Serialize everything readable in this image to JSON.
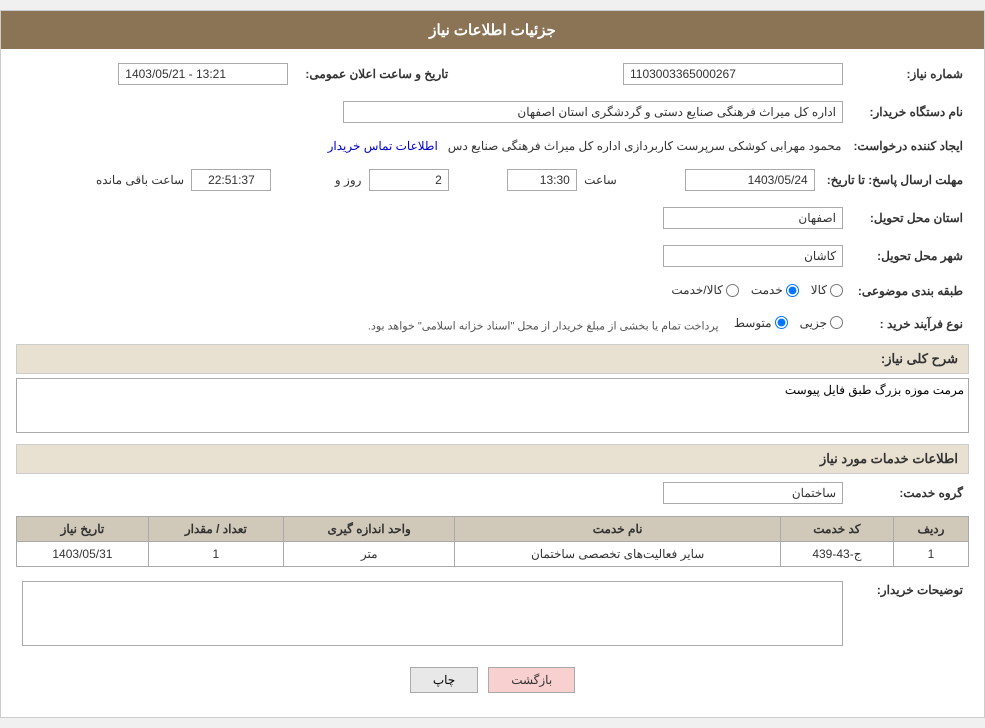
{
  "header": {
    "title": "جزئیات اطلاعات نیاز"
  },
  "fields": {
    "need_number_label": "شماره نیاز:",
    "need_number_value": "1103003365000267",
    "buyer_org_label": "نام دستگاه خریدار:",
    "buyer_org_value": "اداره کل میراث فرهنگی  صنایع دستی و گردشگری استان اصفهان",
    "creator_label": "ایجاد کننده درخواست:",
    "creator_value": "محمود مهرابی کوشکی سرپرست کاربردازی اداره کل میراث فرهنگی  صنایع دس",
    "creator_link": "اطلاعات تماس خریدار",
    "announce_date_label": "تاریخ و ساعت اعلان عمومی:",
    "announce_date_value": "1403/05/21 - 13:21",
    "response_deadline_label": "مهلت ارسال پاسخ: تا تاریخ:",
    "response_date": "1403/05/24",
    "response_time_label": "ساعت",
    "response_time": "13:30",
    "response_days_label": "روز و",
    "response_days": "2",
    "response_remaining_label": "ساعت باقی مانده",
    "response_remaining": "22:51:37",
    "province_label": "استان محل تحویل:",
    "province_value": "اصفهان",
    "city_label": "شهر محل تحویل:",
    "city_value": "کاشان",
    "category_label": "طبقه بندی موضوعی:",
    "category_options": [
      {
        "label": "کالا",
        "value": "kala"
      },
      {
        "label": "خدمت",
        "value": "khedmat"
      },
      {
        "label": "کالا/خدمت",
        "value": "kala_khedmat"
      }
    ],
    "category_selected": "khedmat",
    "process_label": "نوع فرآیند خرید :",
    "process_options": [
      {
        "label": "جزیی",
        "value": "jozi"
      },
      {
        "label": "متوسط",
        "value": "motvaset"
      }
    ],
    "process_selected": "motvaset",
    "process_note": "پرداخت تمام یا بخشی از مبلغ خریدار از محل \"اسناد خزانه اسلامی\" خواهد بود.",
    "need_description_label": "شرح کلی نیاز:",
    "need_description_value": "مرمت موزه بزرگ طبق فایل پیوست",
    "services_section_label": "اطلاعات خدمات مورد نیاز",
    "service_group_label": "گروه خدمت:",
    "service_group_value": "ساختمان",
    "table": {
      "headers": [
        "ردیف",
        "کد خدمت",
        "نام خدمت",
        "واحد اندازه گیری",
        "تعداد / مقدار",
        "تاریخ نیاز"
      ],
      "rows": [
        {
          "row": "1",
          "code": "ج-43-439",
          "name": "سایر فعالیت‌های تخصصی ساختمان",
          "unit": "متر",
          "quantity": "1",
          "date": "1403/05/31"
        }
      ]
    },
    "buyer_notes_label": "توضیحات خریدار:",
    "buyer_notes_value": "",
    "btn_back": "بازگشت",
    "btn_print": "چاپ"
  }
}
